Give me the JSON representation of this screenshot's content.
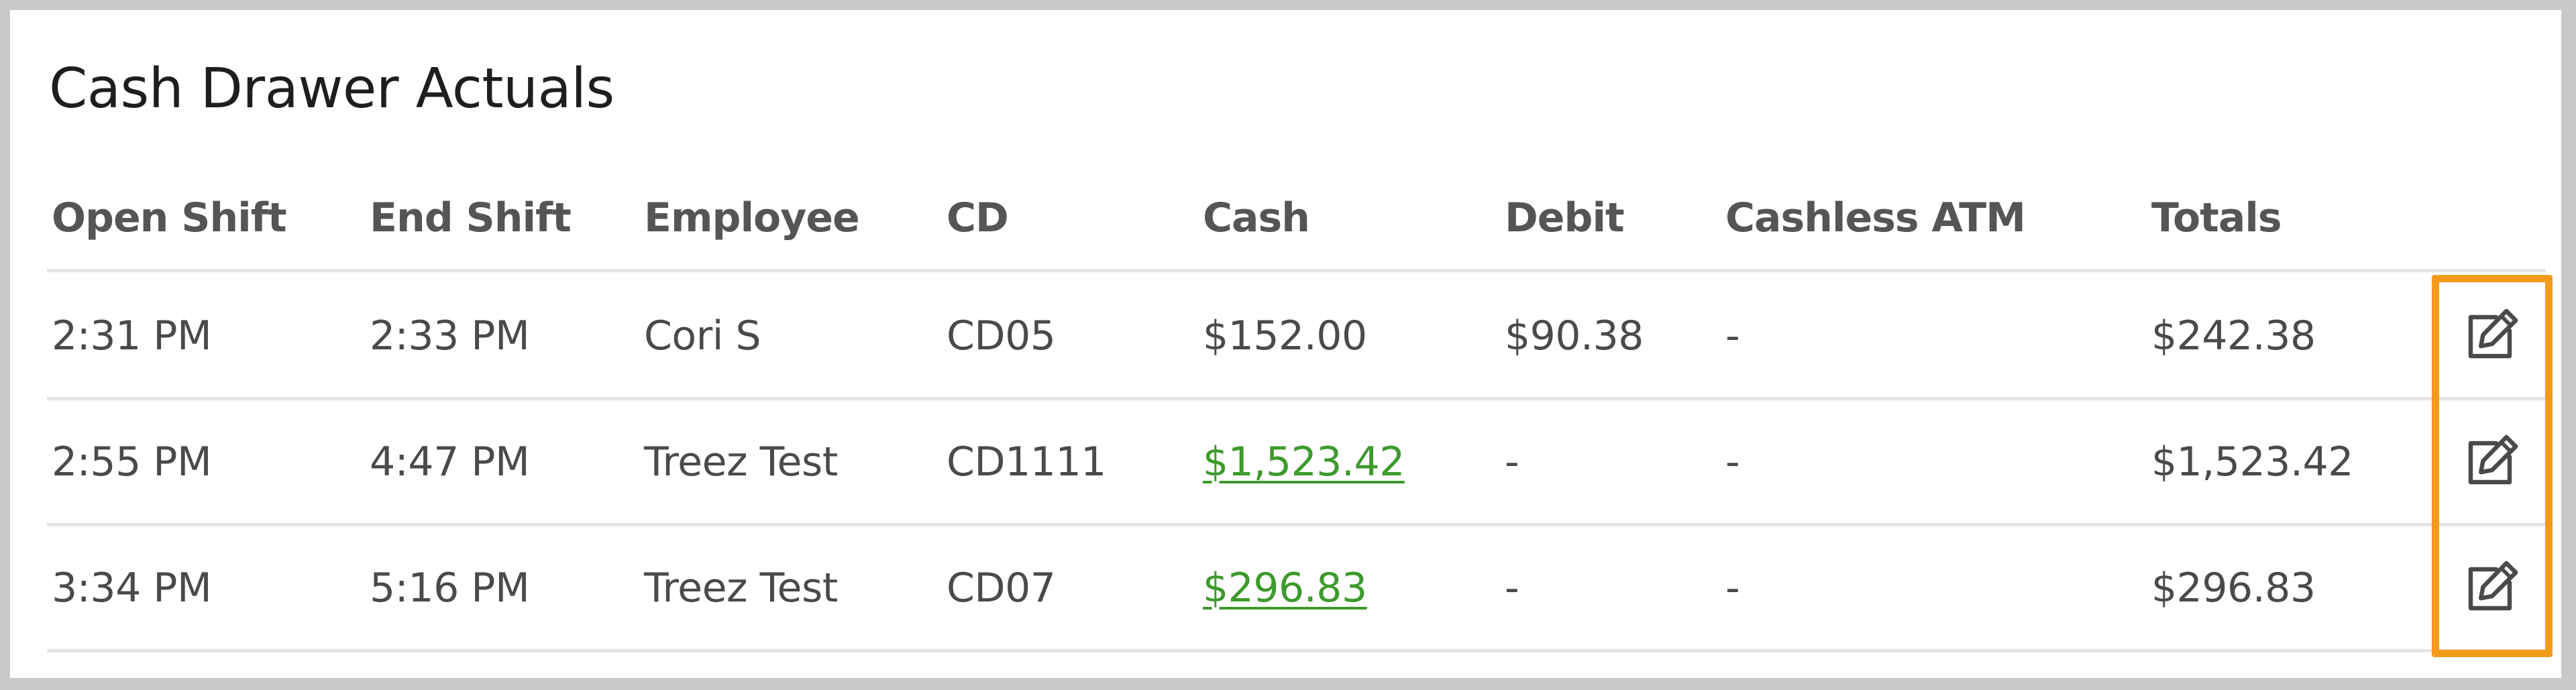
{
  "title": "Cash Drawer Actuals",
  "columns": {
    "open_shift": "Open Shift",
    "end_shift": "End Shift",
    "employee": "Employee",
    "cd": "CD",
    "cash": "Cash",
    "debit": "Debit",
    "cashless_atm": "Cashless ATM",
    "totals": "Totals"
  },
  "rows": [
    {
      "open_shift": "2:31 PM",
      "end_shift": "2:33 PM",
      "employee": "Cori S",
      "cd": "CD05",
      "cash": "$152.00",
      "cash_is_link": false,
      "debit": "$90.38",
      "cashless_atm": "-",
      "totals": "$242.38"
    },
    {
      "open_shift": "2:55 PM",
      "end_shift": "4:47 PM",
      "employee": "Treez Test",
      "cd": "CD1111",
      "cash": "$1,523.42",
      "cash_is_link": true,
      "debit": "-",
      "cashless_atm": "-",
      "totals": "$1,523.42"
    },
    {
      "open_shift": "3:34 PM",
      "end_shift": "5:16 PM",
      "employee": "Treez Test",
      "cd": "CD07",
      "cash": "$296.83",
      "cash_is_link": true,
      "debit": "-",
      "cashless_atm": "-",
      "totals": "$296.83"
    }
  ],
  "icons": {
    "edit": "edit-icon"
  },
  "colors": {
    "link": "#3d9a2c",
    "highlight": "#f39a1b",
    "text": "#4a4a4a",
    "header": "#555555",
    "divider": "#e4e4e4"
  }
}
